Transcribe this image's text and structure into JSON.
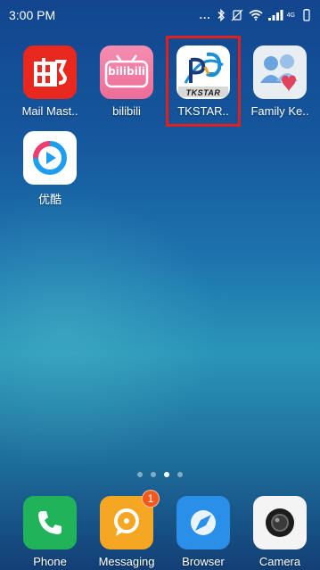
{
  "status_bar": {
    "time": "3:00 PM",
    "more": "...",
    "bluetooth_icon": "bluetooth-icon",
    "silent_icon": "vibrate-off-icon",
    "wifi_icon": "wifi-icon",
    "signal_icon": "signal-icon",
    "signal_type": "4G",
    "battery_icon": "battery-icon"
  },
  "apps": [
    {
      "name": "mail-master",
      "label": "Mail Mast..",
      "color": "#e8271f"
    },
    {
      "name": "bilibili",
      "label": "bilibili",
      "color": "#f07aa2"
    },
    {
      "name": "tkstar",
      "label": "TKSTAR..",
      "color": "#ffffff"
    },
    {
      "name": "family-keeper",
      "label": "Family Ke..",
      "color": "#e9eef2"
    },
    {
      "name": "youku",
      "label": "优酷",
      "color": "#ffffff"
    }
  ],
  "tile_texts": {
    "bilibili_logo": "bilibili",
    "tkstar_logo": "TKSTAR"
  },
  "page_indicator": {
    "count": 4,
    "active": 3
  },
  "dock": [
    {
      "name": "phone",
      "label": "Phone",
      "color": "#20b35a"
    },
    {
      "name": "messaging",
      "label": "Messaging",
      "color": "#f5a623",
      "badge": "1"
    },
    {
      "name": "browser",
      "label": "Browser",
      "color": "#2a8fe8"
    },
    {
      "name": "camera",
      "label": "Camera",
      "color": "#f4f4f4"
    }
  ],
  "highlight_color": "#e0201c"
}
